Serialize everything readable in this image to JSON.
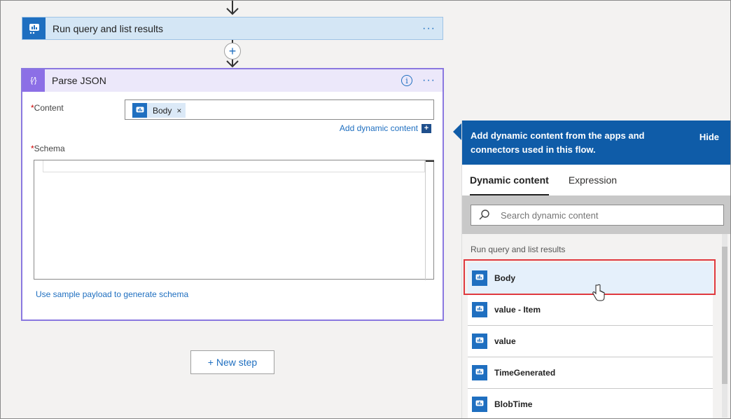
{
  "trigger_step": {
    "title": "Run query and list results",
    "more": "···"
  },
  "insert_step": {
    "symbol": "+"
  },
  "parse_card": {
    "title": "Parse JSON",
    "info": "i",
    "more": "···",
    "content_label": "Content",
    "required_mark": "*",
    "token_label": "Body",
    "token_remove": "×",
    "add_dynamic": "Add dynamic content",
    "add_dynamic_icon": "+",
    "schema_label": "Schema",
    "sample_link": "Use sample payload to generate schema"
  },
  "new_step": {
    "label": "+ New step"
  },
  "dynamic_panel": {
    "header": "Add dynamic content from the apps and connectors used in this flow.",
    "hide": "Hide",
    "tabs": [
      "Dynamic content",
      "Expression"
    ],
    "search_placeholder": "Search dynamic content",
    "group_label": "Run query and list results",
    "items": [
      "Body",
      "value - Item",
      "value",
      "TimeGenerated",
      "BlobTime"
    ]
  },
  "colors": {
    "accent": "#1f6fc0",
    "panel_header": "#0f5ca8",
    "parse_json_icon": "#8c6fe6",
    "highlight_border": "#e0393e"
  },
  "icons": {
    "connector": "azure-monitor-logs-icon",
    "parse_json": "curly-braces-icon",
    "search": "search-icon"
  }
}
